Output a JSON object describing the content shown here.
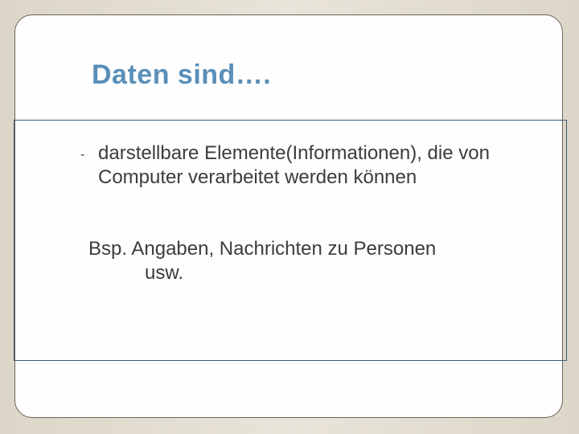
{
  "slide": {
    "title": "Daten sind….",
    "bullet": {
      "marker": "-",
      "text": "darstellbare Elemente(Informationen), die von Computer verarbeitet werden können"
    },
    "example": {
      "prefix": "Bsp. Angaben, Nachrichten zu Personen",
      "cont": "usw."
    }
  }
}
